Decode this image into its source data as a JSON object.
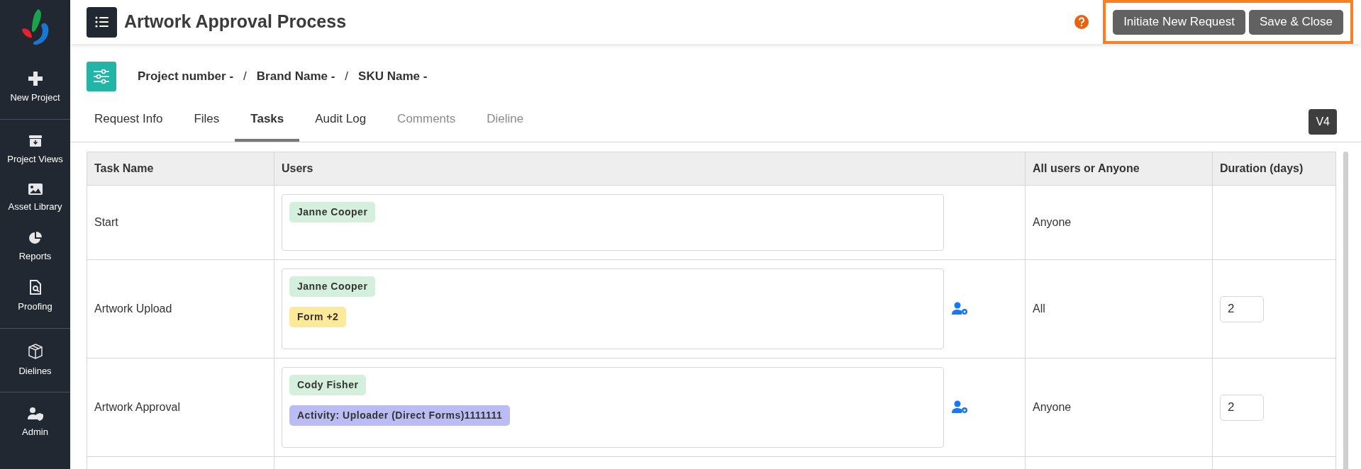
{
  "sidebar": {
    "groups": [
      [
        {
          "label": "New Project",
          "kind": "plus"
        }
      ],
      [
        {
          "label": "Project Views",
          "kind": "archive"
        },
        {
          "label": "Asset Library",
          "kind": "image"
        },
        {
          "label": "Reports",
          "kind": "pie"
        },
        {
          "label": "Proofing",
          "kind": "proof"
        }
      ],
      [
        {
          "label": "Dielines",
          "kind": "box"
        }
      ],
      [
        {
          "label": "Admin",
          "kind": "admin"
        }
      ]
    ]
  },
  "header": {
    "title": "Artwork Approval Process",
    "buttons": [
      "Initiate New Request",
      "Save & Close"
    ]
  },
  "breadcrumb": [
    {
      "kind": "item",
      "text": "Project number -"
    },
    {
      "kind": "separator",
      "text": "/"
    },
    {
      "kind": "item",
      "text": "Brand Name -"
    },
    {
      "kind": "separator",
      "text": "/"
    },
    {
      "kind": "item",
      "text": "SKU Name -"
    }
  ],
  "tabs": [
    {
      "label": "Request Info",
      "selected": false,
      "disabled": false
    },
    {
      "label": "Files",
      "selected": false,
      "disabled": false
    },
    {
      "label": "Tasks",
      "selected": true,
      "disabled": false
    },
    {
      "label": "Audit Log",
      "selected": false,
      "disabled": false
    },
    {
      "label": "Comments",
      "selected": false,
      "disabled": true
    },
    {
      "label": "Dieline",
      "selected": false,
      "disabled": true
    }
  ],
  "version": "V4",
  "table": {
    "columns": [
      "Task Name",
      "Users",
      "All users or Anyone",
      "Duration (days)"
    ],
    "rows": [
      {
        "task": "Start",
        "tags": [
          {
            "text": "Janne Cooper",
            "color": "#d4f0dc"
          }
        ],
        "user_settings": false,
        "mode": "Anyone"
      },
      {
        "task": "Artwork Upload",
        "tags": [
          {
            "text": "Janne Cooper",
            "color": "#d4f0dc"
          },
          {
            "text": "Form +2",
            "color": "#fde99a"
          }
        ],
        "user_settings": true,
        "mode": "All",
        "duration": "2"
      },
      {
        "task": "Artwork Approval",
        "tags": [
          {
            "text": "Cody Fisher",
            "color": "#d4f0dc"
          },
          {
            "text": "Activity: Uploader (Direct Forms)1111111",
            "color": "#bcbcf5"
          }
        ],
        "user_settings": true,
        "mode": "Anyone",
        "duration": "2"
      }
    ]
  }
}
